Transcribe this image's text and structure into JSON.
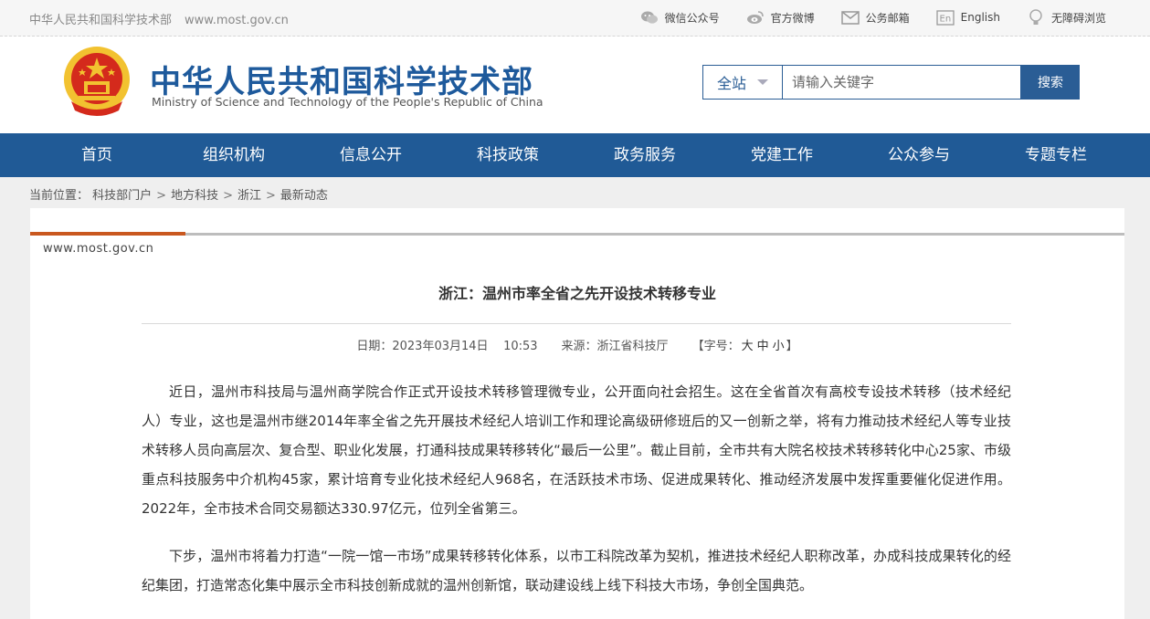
{
  "topbar": {
    "site_name": "中华人民共和国科学技术部",
    "site_url": "www.most.gov.cn",
    "links": [
      {
        "label": "微信公众号",
        "icon": "wechat-icon"
      },
      {
        "label": "官方微博",
        "icon": "weibo-icon"
      },
      {
        "label": "公务邮箱",
        "icon": "mail-icon"
      },
      {
        "label": "English",
        "icon": "en-icon"
      },
      {
        "label": "无障碍浏览",
        "icon": "accessibility-icon"
      }
    ]
  },
  "header": {
    "title_cn": "中华人民共和国科学技术部",
    "title_en": "Ministry of Science and Technology of the People's Republic of China"
  },
  "search": {
    "scope": "全站",
    "placeholder": "请输入关键字",
    "button": "搜索"
  },
  "nav": {
    "items": [
      "首页",
      "组织机构",
      "信息公开",
      "科技政策",
      "政务服务",
      "党建工作",
      "公众参与",
      "专题专栏"
    ]
  },
  "breadcrumb": {
    "prefix": "当前位置：",
    "items": [
      "科技部门户",
      "地方科技",
      "浙江",
      "最新动态"
    ],
    "separator": ">"
  },
  "article": {
    "site_mark": "www.most.gov.cn",
    "title": "浙江：温州市率全省之先开设技术转移专业",
    "date_label": "日期：",
    "date": "2023年03月14日",
    "time": "10:53",
    "source_label": "来源：",
    "source": "浙江省科技厅",
    "font_label_open": "【字号：",
    "font_sizes": [
      "大",
      "中",
      "小"
    ],
    "font_label_close": "】",
    "paragraphs": [
      "近日，温州市科技局与温州商学院合作正式开设技术转移管理微专业，公开面向社会招生。这在全省首次有高校专设技术转移（技术经纪人）专业，这也是温州市继2014年率全省之先开展技术经纪人培训工作和理论高级研修班后的又一创新之举，将有力推动技术经纪人等专业技术转移人员向高层次、复合型、职业化发展，打通科技成果转移转化“最后一公里”。截止目前，全市共有大院名校技术转移转化中心25家、市级重点科技服务中介机构45家，累计培育专业化技术经纪人968名，在活跃技术市场、促进成果转化、推动经济发展中发挥重要催化促进作用。2022年，全市技术合同交易额达330.97亿元，位列全省第三。",
      "下步，温州市将着力打造“一院一馆一市场”成果转移转化体系，以市工科院改革为契机，推进技术经纪人职称改革，办成科技成果转化的经纪集团，打造常态化集中展示全市科技创新成就的温州创新馆，联动建设线上线下科技大市场，争创全国典范。"
    ]
  },
  "colors": {
    "brand_blue": "#205a96",
    "accent_orange": "#c9581f",
    "emblem_red": "#d42a1c",
    "emblem_gold": "#f2c230"
  }
}
